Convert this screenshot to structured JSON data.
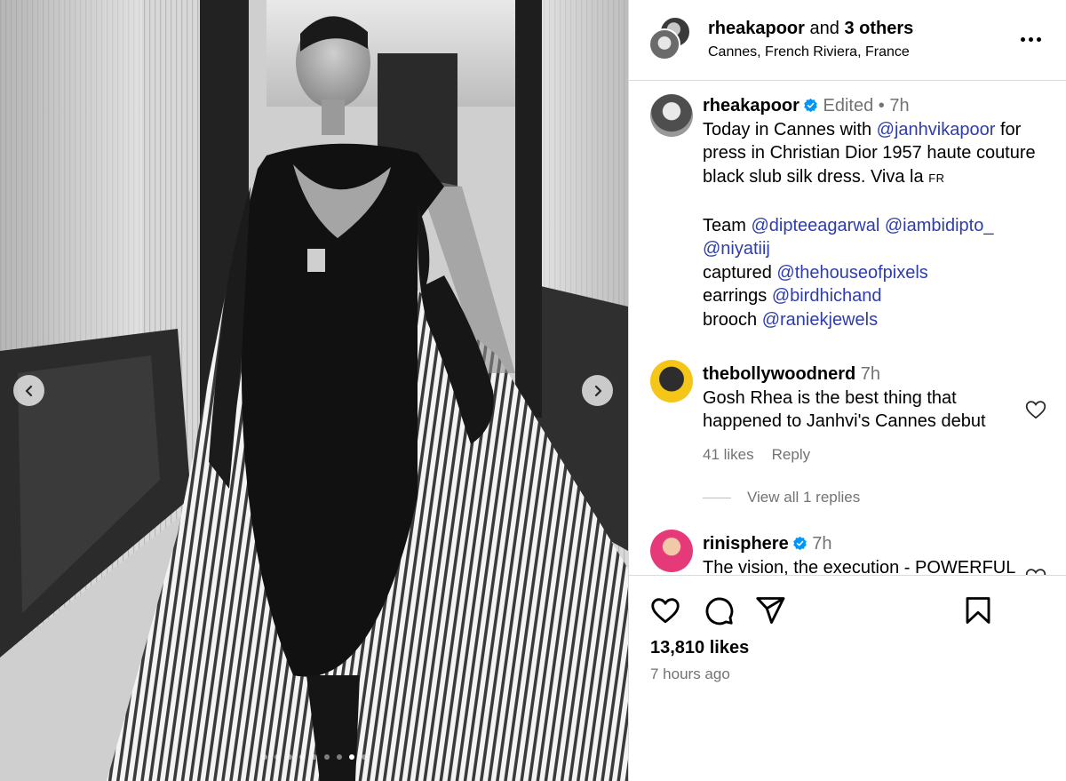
{
  "post_header": {
    "title_user": "rheakapoor",
    "title_and": "and",
    "title_others": "3 others",
    "location": "Cannes, French Riviera, France"
  },
  "caption": {
    "username": "rheakapoor",
    "edited": "Edited",
    "separator": "•",
    "time": "7h",
    "line1_text": "Today in Cannes with ",
    "mention_janhvi": "@janhvikapoor",
    "line1_rest": " for press in Christian Dior 1957 haute couture black slub silk dress. Viva la ",
    "fr": "FR",
    "team_label": "Team ",
    "mention_diptee": "@dipteeagarwal",
    "mention_iambidipto": "@iambidipto_",
    "mention_niyatiij": "@niyatiij",
    "captured_label": "captured ",
    "mention_pixels": "@thehouseofpixels",
    "earrings_label": "earrings ",
    "mention_birdhichand": "@birdhichand",
    "brooch_label": "brooch ",
    "mention_raniek": "@raniekjewels"
  },
  "comments": [
    {
      "username": "thebollywoodnerd",
      "time": "7h",
      "text": "Gosh Rhea is the best thing that happened to Janhvi's Cannes debut",
      "likes": "41 likes",
      "reply": "Reply",
      "view_replies": "View all 1 replies"
    },
    {
      "username": "rinisphere",
      "time": "7h",
      "text": "The vision, the execution - POWERFUL"
    }
  ],
  "footer": {
    "likes": "13,810 likes",
    "time_ago": "7 hours ago"
  },
  "carousel": {
    "total": 9,
    "active_index": 7
  },
  "icons": {
    "prev": "chevron-left-icon",
    "next": "chevron-right-icon",
    "more": "more-horizontal-icon",
    "like": "heart-icon",
    "comment": "comment-bubble-icon",
    "share": "paper-plane-icon",
    "save": "bookmark-icon",
    "verified": "verified-badge-icon"
  },
  "colors": {
    "mention": "#2d3db0",
    "secondary_text": "#737373",
    "verified": "#0095f6",
    "divider": "#dbdbdb"
  }
}
